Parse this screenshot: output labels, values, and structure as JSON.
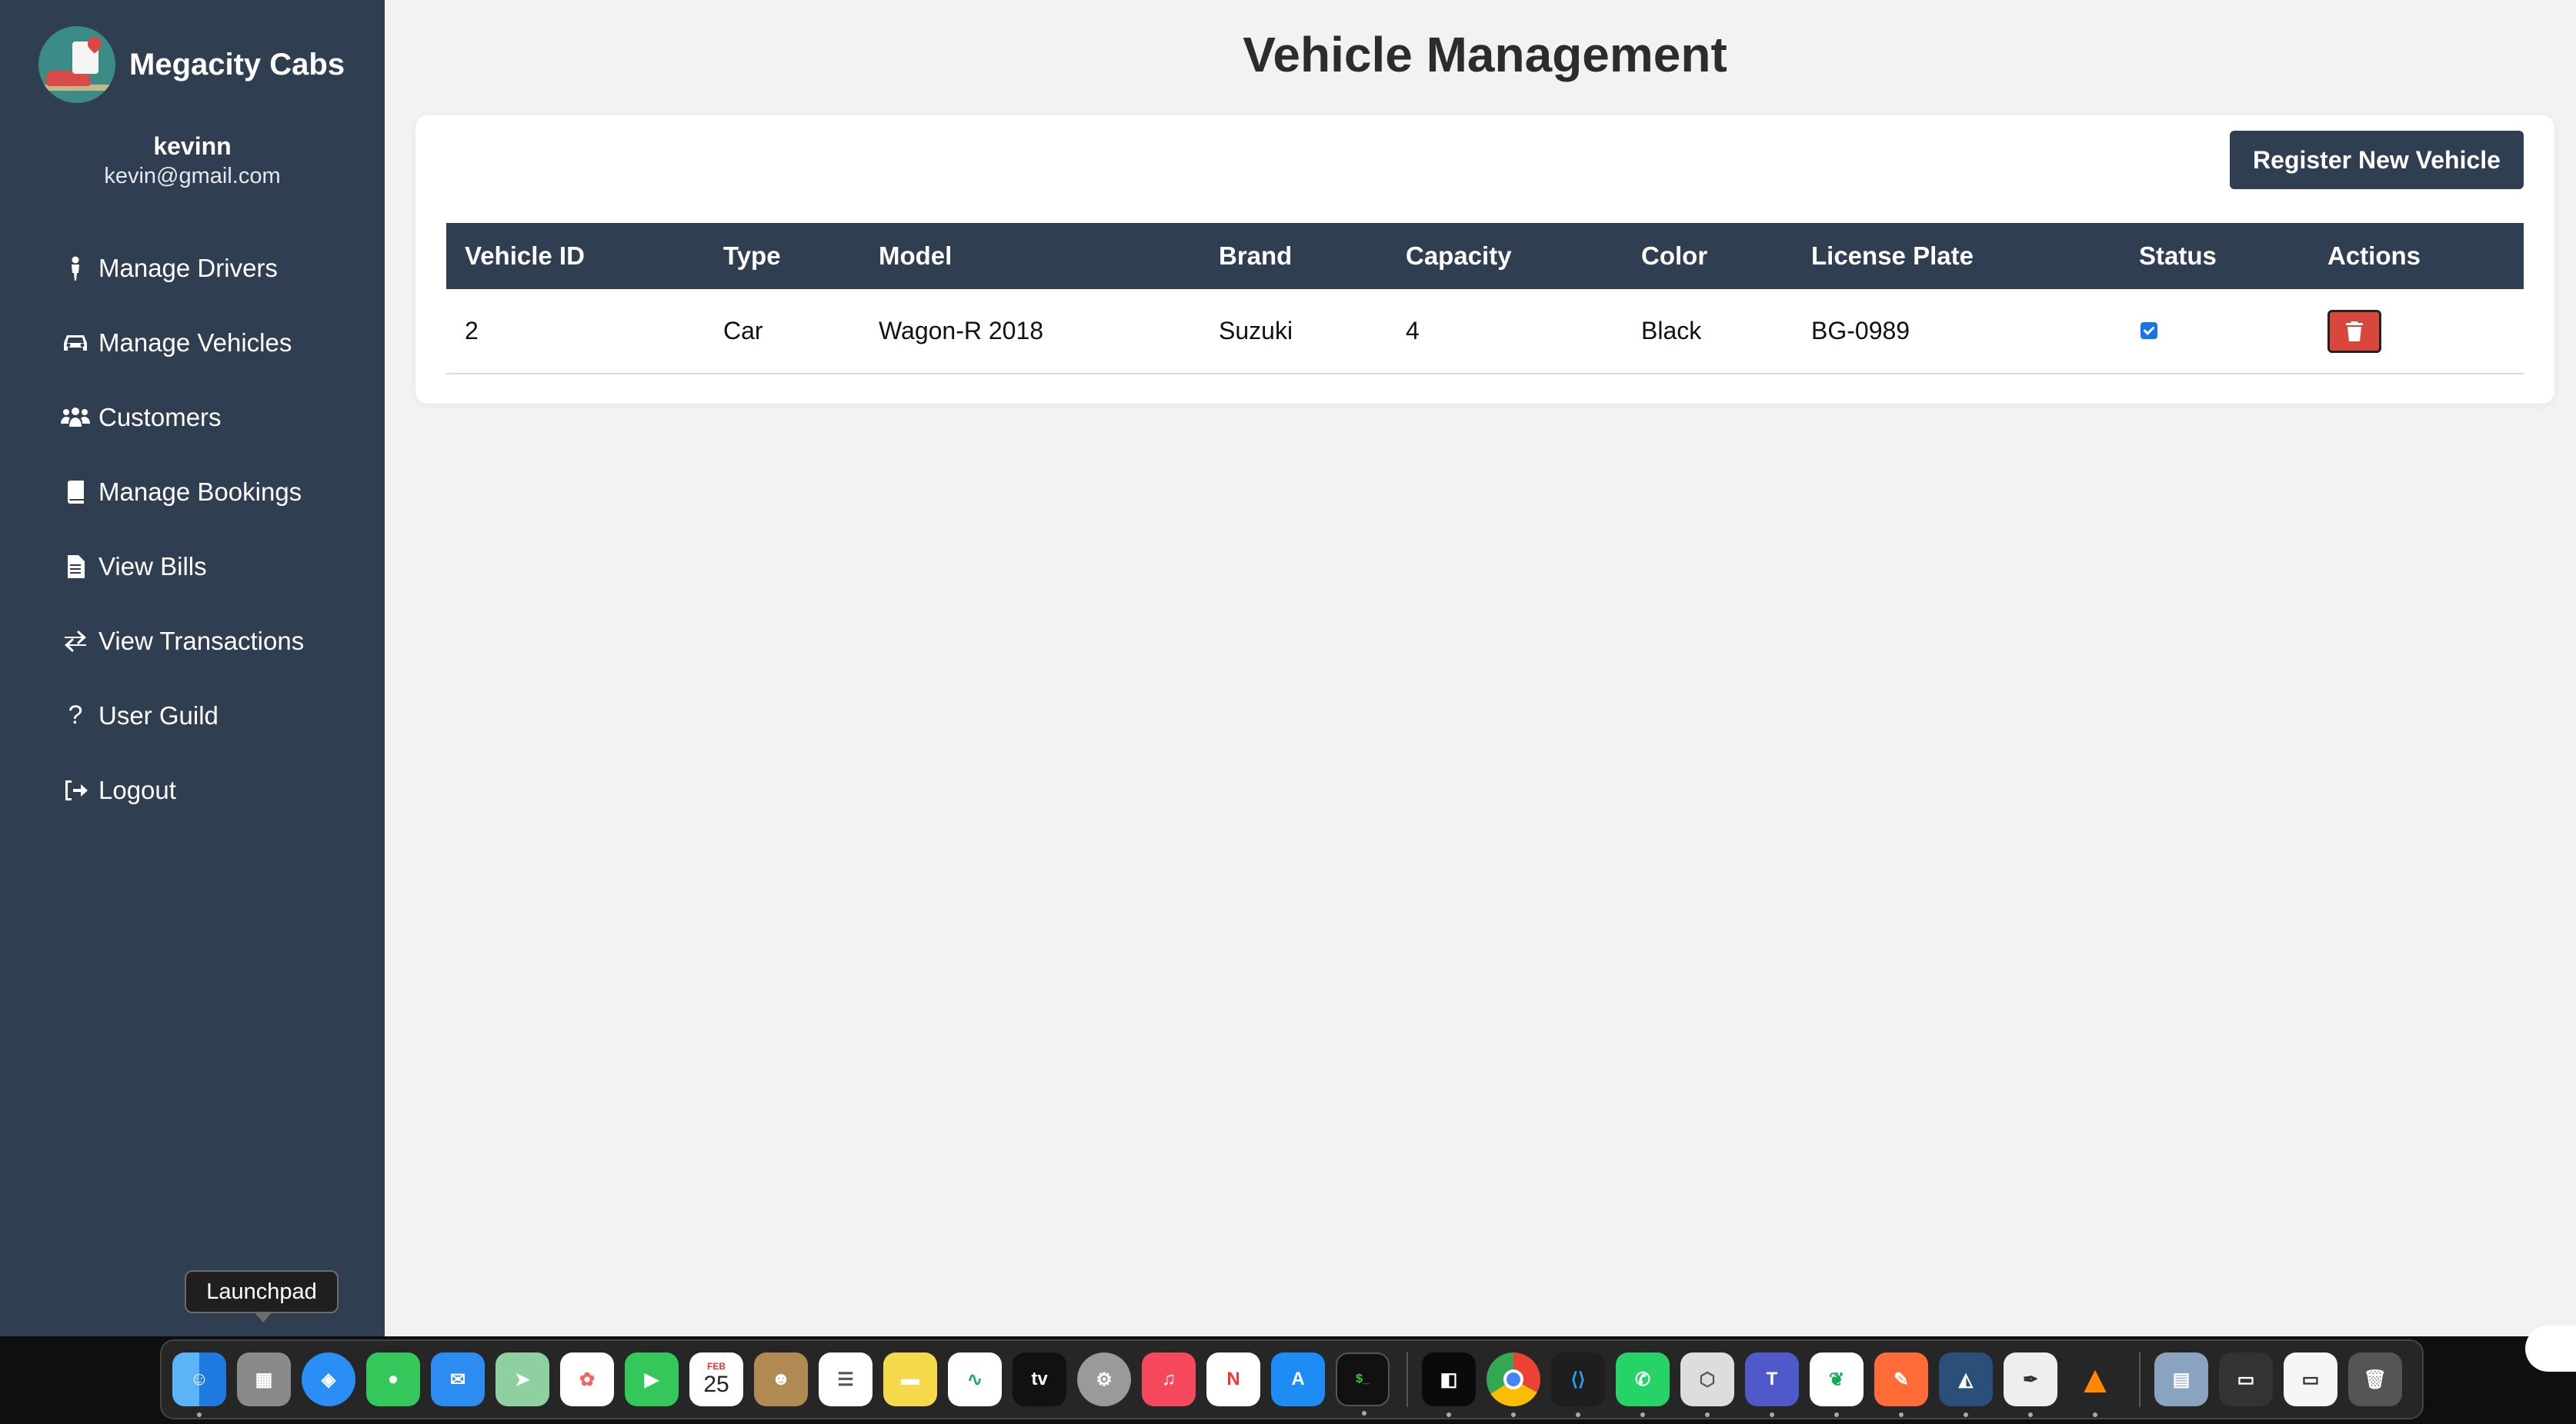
{
  "app": {
    "brand": "Megacity Cabs",
    "user_name": "kevinn",
    "user_email": "kevin@gmail.com"
  },
  "sidebar": {
    "items": [
      {
        "label": "Manage Drivers",
        "icon": "person-walking-icon"
      },
      {
        "label": "Manage Vehicles",
        "icon": "car-icon"
      },
      {
        "label": "Customers",
        "icon": "users-icon"
      },
      {
        "label": "Manage Bookings",
        "icon": "book-icon"
      },
      {
        "label": "View Bills",
        "icon": "file-icon"
      },
      {
        "label": "View Transactions",
        "icon": "exchange-icon"
      },
      {
        "label": "User Guild",
        "icon": "question-icon"
      },
      {
        "label": "Logout",
        "icon": "logout-icon"
      }
    ]
  },
  "main": {
    "title": "Vehicle Management",
    "register_label": "Register New Vehicle",
    "table": {
      "headers": [
        "Vehicle ID",
        "Type",
        "Model",
        "Brand",
        "Capacity",
        "Color",
        "License Plate",
        "Status",
        "Actions"
      ],
      "rows": [
        {
          "id": "2",
          "type": "Car",
          "model": "Wagon-R 2018",
          "brand": "Suzuki",
          "capacity": "4",
          "color": "Black",
          "plate": "BG-0989",
          "status_checked": true
        }
      ]
    }
  },
  "dock": {
    "tooltip": "Launchpad",
    "calendar_month": "FEB",
    "calendar_day": "25",
    "apps": [
      "finder",
      "launchpad",
      "safari",
      "messages",
      "mail",
      "maps",
      "photos",
      "facetime",
      "calendar",
      "contacts",
      "reminders",
      "notes",
      "freeform",
      "tv",
      "music",
      "news",
      "app-store",
      "terminal",
      "settings",
      "cursor",
      "chrome",
      "vscode",
      "whatsapp",
      "intellij",
      "teams",
      "mongodb",
      "postman",
      "mysql-workbench",
      "textedit",
      "vlc",
      "downloads",
      "screens",
      "files",
      "trash"
    ]
  },
  "colors": {
    "sidebar": "#2f3e51",
    "header": "#2f3e51",
    "delete": "#d9463b",
    "accent": "#1a73e8"
  }
}
